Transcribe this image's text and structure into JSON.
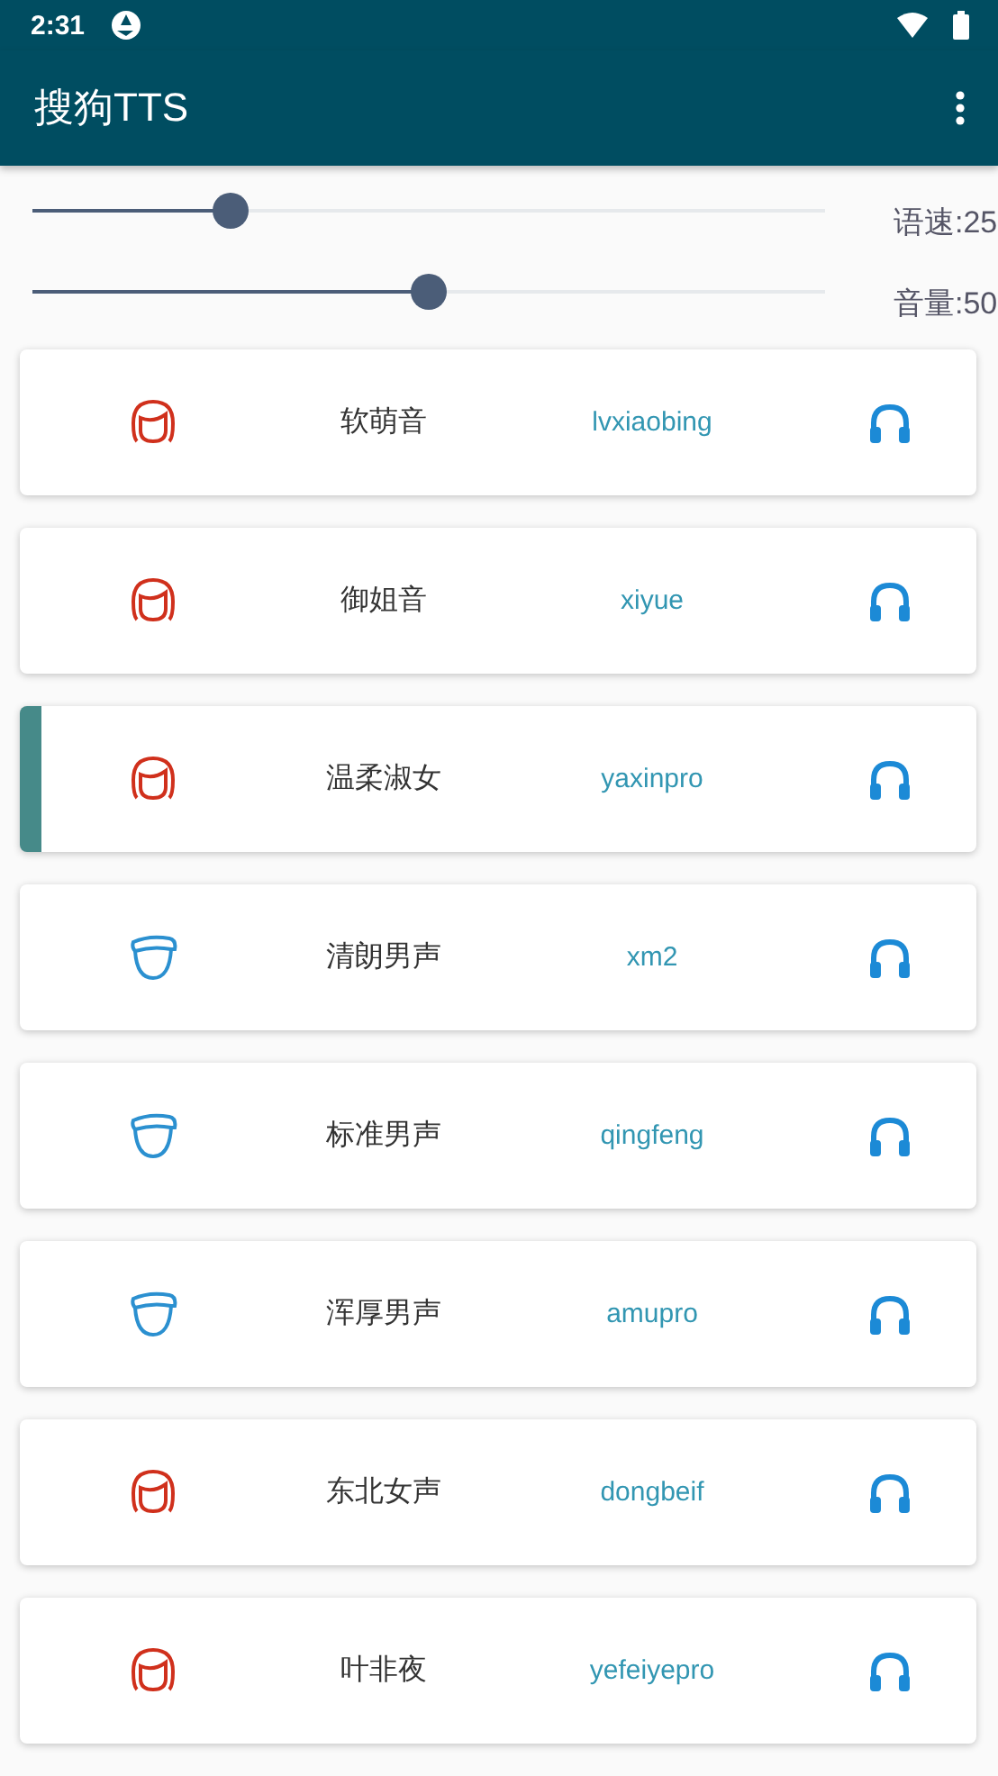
{
  "status_bar": {
    "time": "2:31"
  },
  "app_bar": {
    "title": "搜狗TTS"
  },
  "sliders": [
    {
      "label": "语速:25",
      "level": 0.25
    },
    {
      "label": "音量:50",
      "level": 0.5
    }
  ],
  "voices": [
    {
      "kind": "female",
      "name": "软萌音",
      "code": "lvxiaobing",
      "selected": false
    },
    {
      "kind": "female",
      "name": "御姐音",
      "code": "xiyue",
      "selected": false
    },
    {
      "kind": "female",
      "name": "温柔淑女",
      "code": "yaxinpro",
      "selected": true
    },
    {
      "kind": "male",
      "name": "清朗男声",
      "code": "xm2",
      "selected": false
    },
    {
      "kind": "male",
      "name": "标准男声",
      "code": "qingfeng",
      "selected": false
    },
    {
      "kind": "male",
      "name": "浑厚男声",
      "code": "amupro",
      "selected": false
    },
    {
      "kind": "female",
      "name": "东北女声",
      "code": "dongbeif",
      "selected": false
    },
    {
      "kind": "female",
      "name": "叶非夜",
      "code": "yefeiyepro",
      "selected": false
    }
  ]
}
